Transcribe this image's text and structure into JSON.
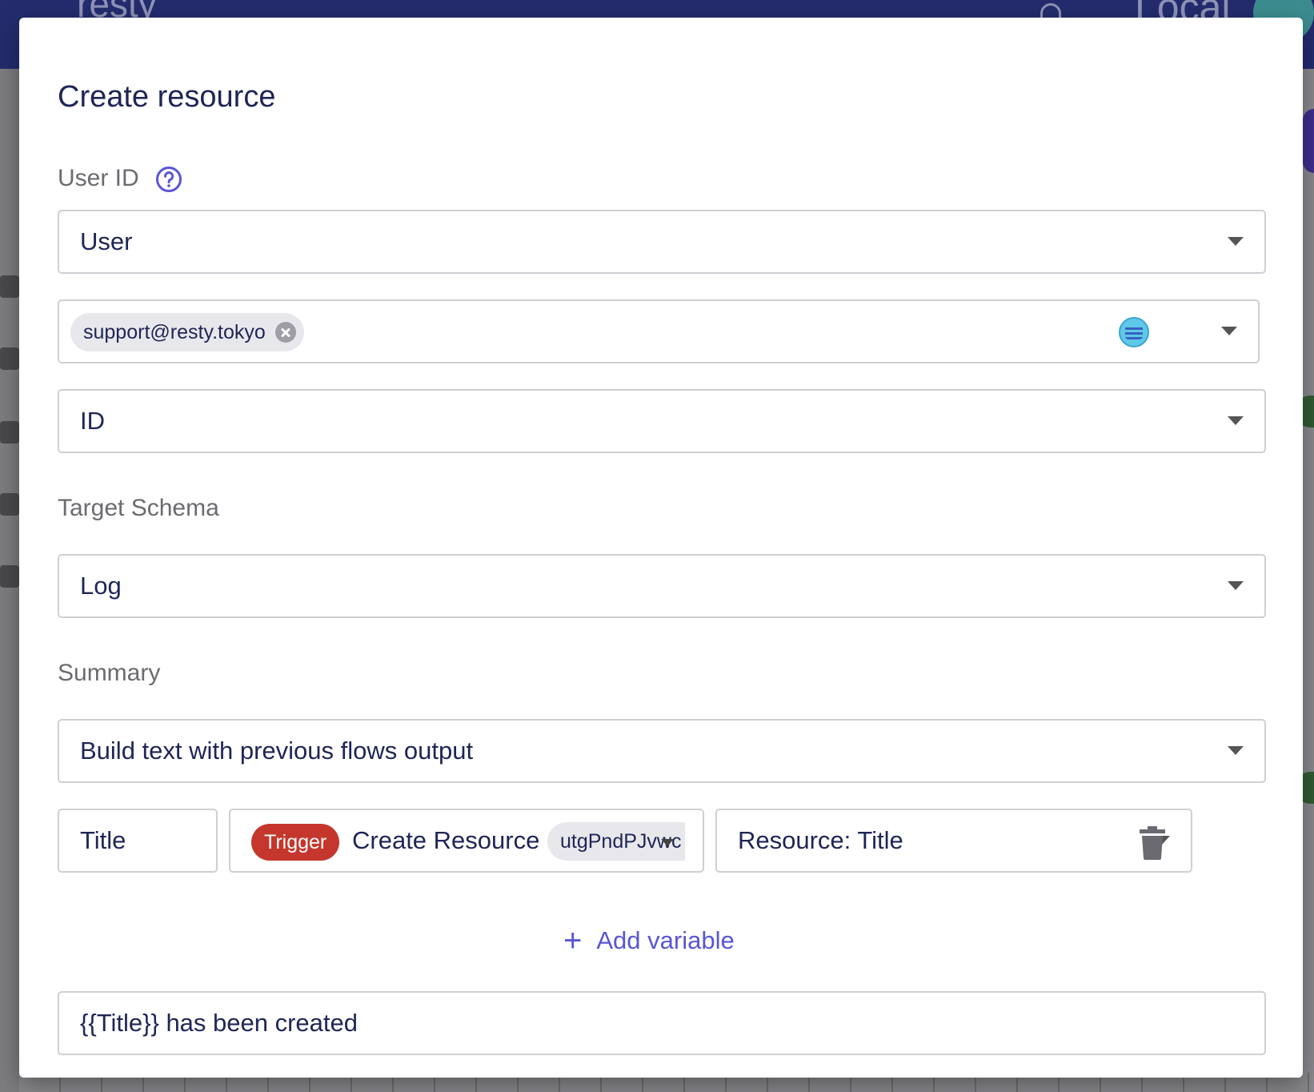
{
  "background": {
    "logo_text": "resty",
    "env_text": "Local"
  },
  "modal": {
    "title": "Create resource",
    "user_id": {
      "label": "User ID",
      "help_icon": "help-circle-icon",
      "source_select": "User",
      "selected_user_chip": "support@resty.tokyo",
      "field_select": "ID"
    },
    "target_schema": {
      "label": "Target Schema",
      "value": "Log"
    },
    "summary": {
      "label": "Summary",
      "mode_select": "Build text with previous flows output",
      "variable": {
        "name": "Title",
        "trigger_badge": "Trigger",
        "flow_name": "Create Resource",
        "flow_id": "utgPndPJvwc",
        "output_select": "Resource: Title"
      },
      "add_variable_label": "Add variable",
      "template_text": "{{Title}} has been created"
    }
  },
  "colors": {
    "accent": "#5a55d6",
    "trigger": "#c5372c",
    "text": "#1f2555",
    "header": "#242c6e"
  }
}
